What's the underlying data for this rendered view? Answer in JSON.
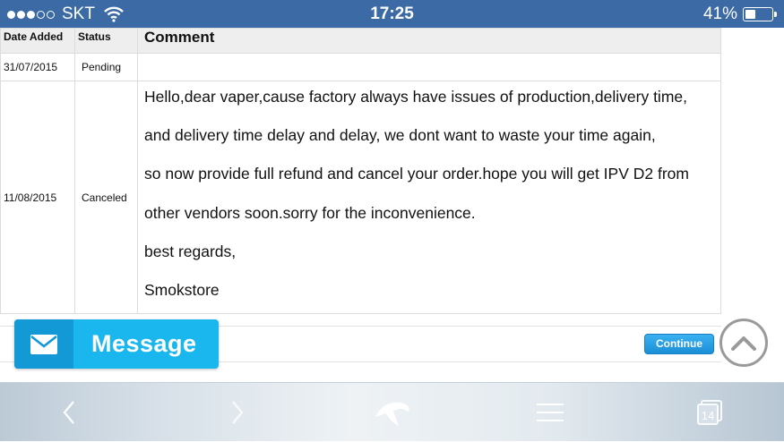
{
  "status_bar": {
    "carrier": "SKT",
    "time": "17:25",
    "battery_percent": "41%",
    "battery_level": 0.41,
    "signal_bars_filled": 3,
    "signal_bars_total": 5,
    "bar_color": "#3b6aa4"
  },
  "history_table": {
    "headers": {
      "date": "Date Added",
      "status": "Status",
      "comment": "Comment"
    },
    "rows": [
      {
        "date": "31/07/2015",
        "status": "Pending",
        "comment": ""
      },
      {
        "date": "11/08/2015",
        "status": "Canceled",
        "comment_lines": [
          "Hello,dear vaper,cause factory always have issues of production,delivery time,",
          "and delivery time delay and delay, we dont want to waste your time again,",
          "so now provide full refund and cancel your order.hope you will get IPV D2 from",
          "other vendors soon.sorry for the inconvenience.",
          "best regards,",
          "Smokstore"
        ]
      }
    ]
  },
  "buttons": {
    "continue_label": "Continue",
    "message_label": "Message",
    "message_icon": "envelope-icon",
    "scroll_top_icon": "chevron-up-icon",
    "accent_color": "#1ab6ee"
  },
  "toolbar": {
    "back_icon": "chevron-left-icon",
    "forward_icon": "chevron-right-icon",
    "home_icon": "dolphin-icon",
    "menu_icon": "hamburger-menu-icon",
    "tabs_icon": "tabs-icon",
    "tab_count": "14"
  }
}
